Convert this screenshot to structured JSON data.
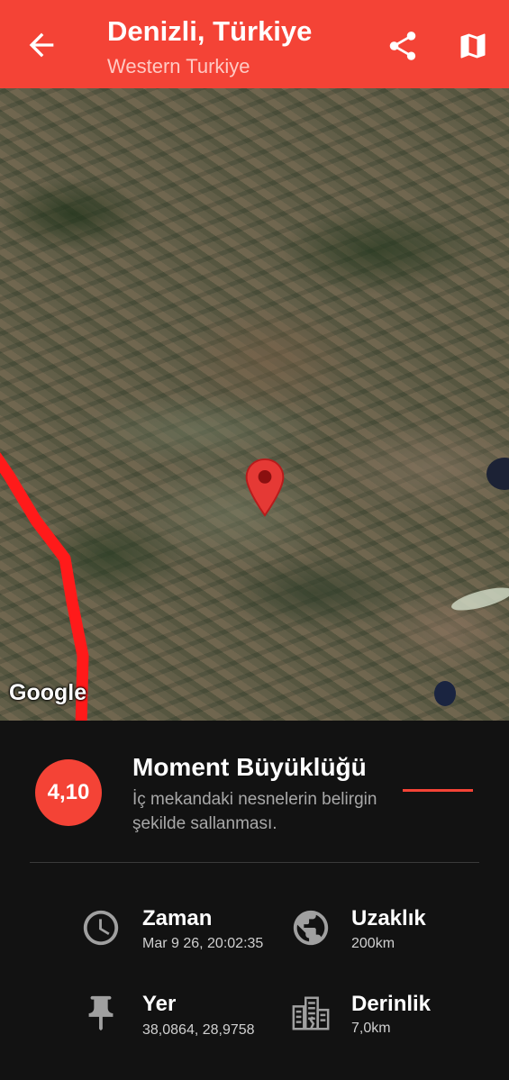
{
  "appbar": {
    "title": "Denizli, Türkiye",
    "subtitle": "Western Turkiye",
    "back_icon": "arrow-back-icon",
    "share_icon": "share-icon",
    "map_icon": "map-icon",
    "color": "#f44336"
  },
  "map": {
    "attribution": "Google",
    "marker_icon": "map-pin-icon",
    "route_color": "#ff1a1a"
  },
  "magnitude": {
    "value": "4,10",
    "title": "Moment Büyüklüğü",
    "description": "İç mekandaki nesnelerin belirgin şekilde sallanması.",
    "accent_color": "#f44336"
  },
  "details": {
    "time": {
      "label": "Zaman",
      "value": "Mar 9 26, 20:02:35",
      "icon": "clock-icon"
    },
    "distance": {
      "label": "Uzaklık",
      "value": "200km",
      "icon": "globe-icon"
    },
    "location": {
      "label": "Yer",
      "value": "38,0864, 28,9758",
      "icon": "pushpin-icon"
    },
    "depth": {
      "label": "Derinlik",
      "value": "7,0km",
      "icon": "buildings-icon"
    }
  }
}
